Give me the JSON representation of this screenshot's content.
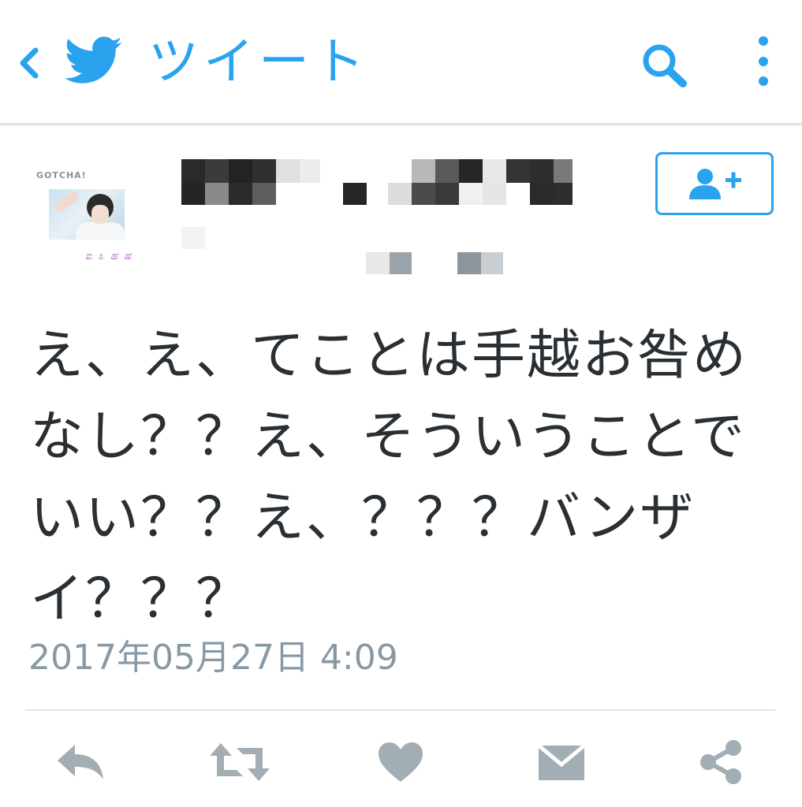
{
  "header": {
    "title": "ツイート"
  },
  "tweet": {
    "text": "え、え、てことは手越お咎めなし？？え、そういうことでいい？？え、？？？バンザイ？？？",
    "timestamp": "2017年05月27日 4:09"
  },
  "colors": {
    "accent": "#2aa3ef",
    "text": "#292f33",
    "muted": "#8899a6",
    "action_icon": "#a3adb4"
  },
  "icons": {
    "back": "chevron-left-icon",
    "logo": "twitter-bird-icon",
    "search": "search-icon",
    "more": "more-vertical-icon",
    "follow": "add-user-icon",
    "reply": "reply-icon",
    "retweet": "retweet-icon",
    "like": "heart-icon",
    "message": "envelope-icon",
    "share": "share-icon"
  }
}
